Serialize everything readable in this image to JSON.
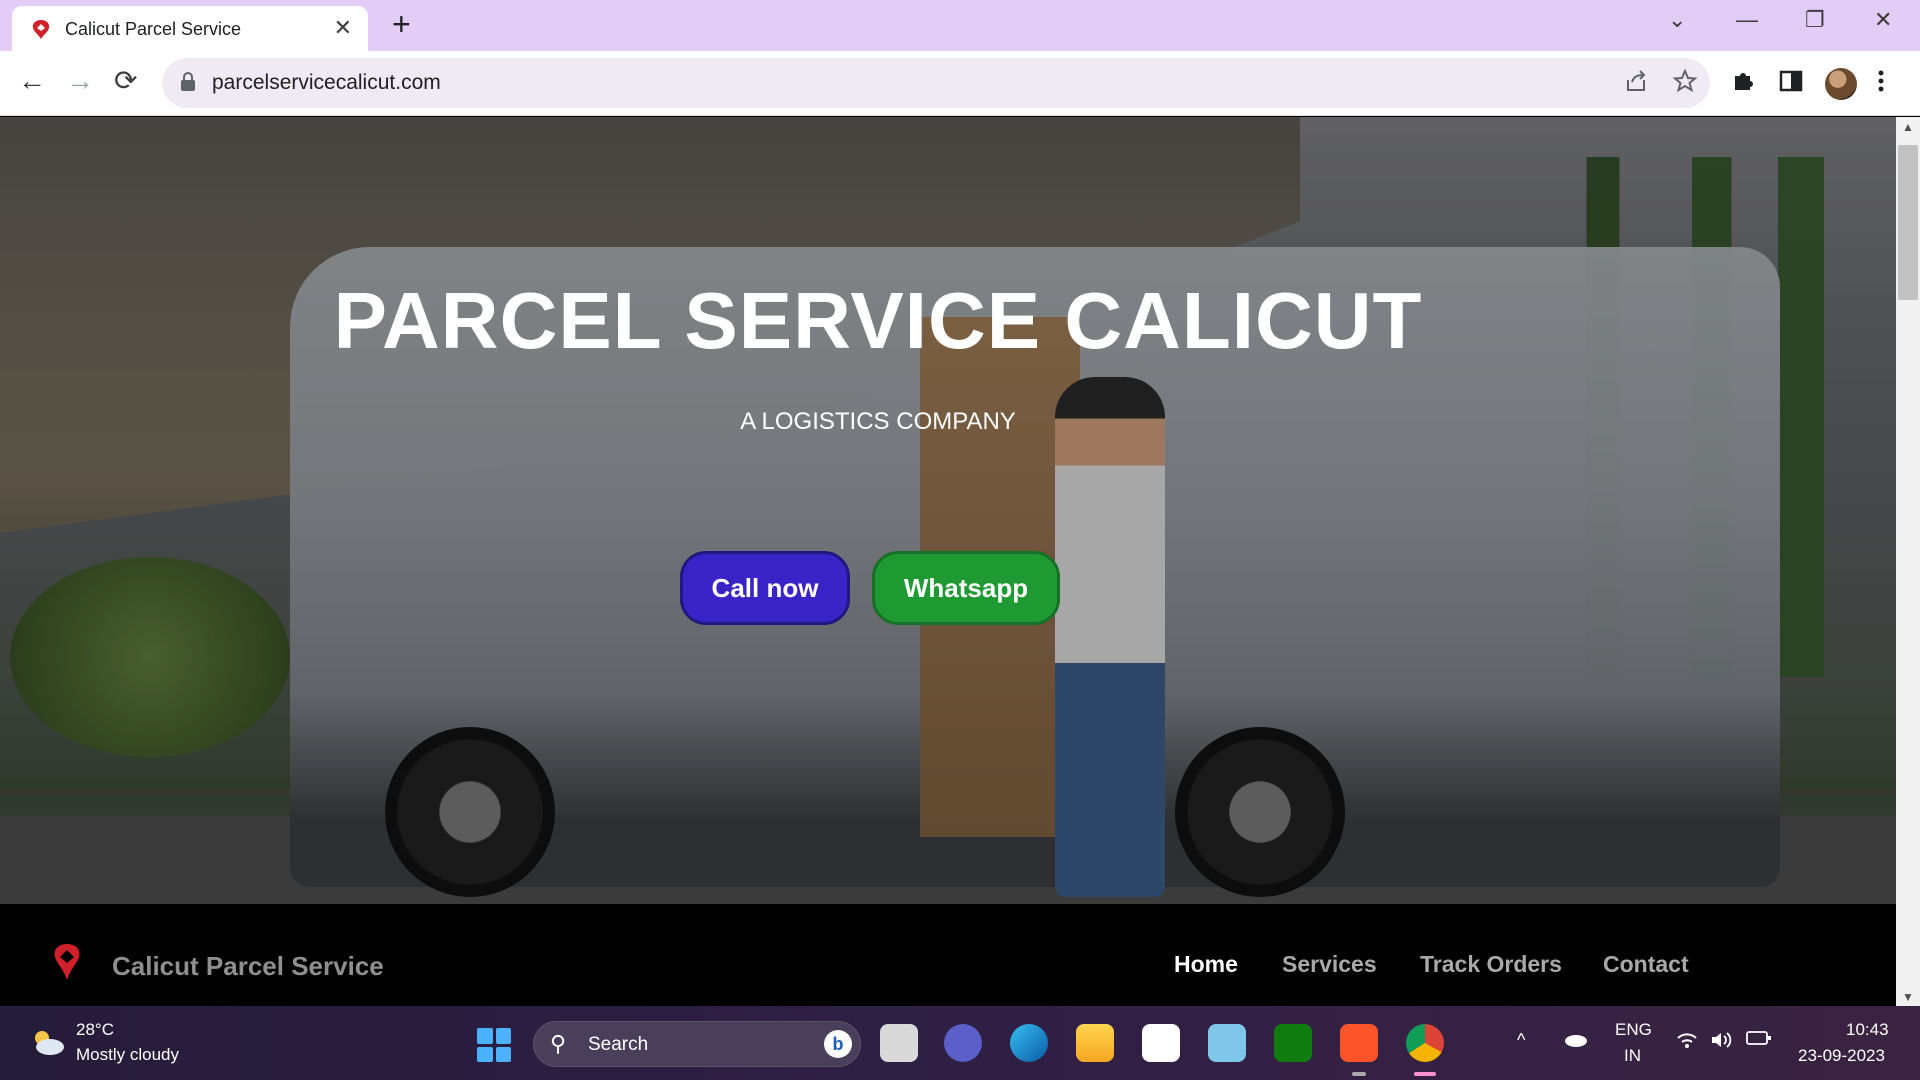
{
  "browser": {
    "tab_title": "Calicut Parcel Service",
    "tab_close": "✕",
    "new_tab": "+",
    "url": "parcelservicecalicut.com",
    "window_controls": [
      "⌄",
      "—",
      "❐",
      "✕"
    ],
    "nav": {
      "back": "←",
      "forward": "→",
      "reload": "⟳"
    },
    "toolbar_icons": [
      "share-icon",
      "star-icon",
      "extensions-icon",
      "side-panel-icon",
      "profile-avatar",
      "menu-icon"
    ]
  },
  "hero": {
    "title": "PARCEL SERVICE CALICUT",
    "subtitle": "A LOGISTICS COMPANY",
    "call_button": "Call now",
    "whatsapp_button": "Whatsapp",
    "colors": {
      "call": "#3b24c7",
      "whatsapp": "#1f9a33"
    }
  },
  "navbar": {
    "brand": "Calicut Parcel Service",
    "logo_color": "#d0202a",
    "links": [
      {
        "label": "Home",
        "active": true
      },
      {
        "label": "Services",
        "active": false
      },
      {
        "label": "Track Orders",
        "active": false
      },
      {
        "label": "Contact",
        "active": false
      }
    ]
  },
  "taskbar": {
    "weather_temp": "28°C",
    "weather_condition": "Mostly cloudy",
    "search_label": "Search",
    "bing": "b",
    "apps": [
      "task-view-icon",
      "teams-icon",
      "edge-icon",
      "file-explorer-icon",
      "store-icon",
      "photos-icon",
      "xbox-icon",
      "brave-icon",
      "chrome-icon"
    ],
    "tray": {
      "chevron": "^",
      "lang_line1": "ENG",
      "lang_line2": "IN"
    },
    "time": "10:43",
    "date": "23-09-2023"
  }
}
